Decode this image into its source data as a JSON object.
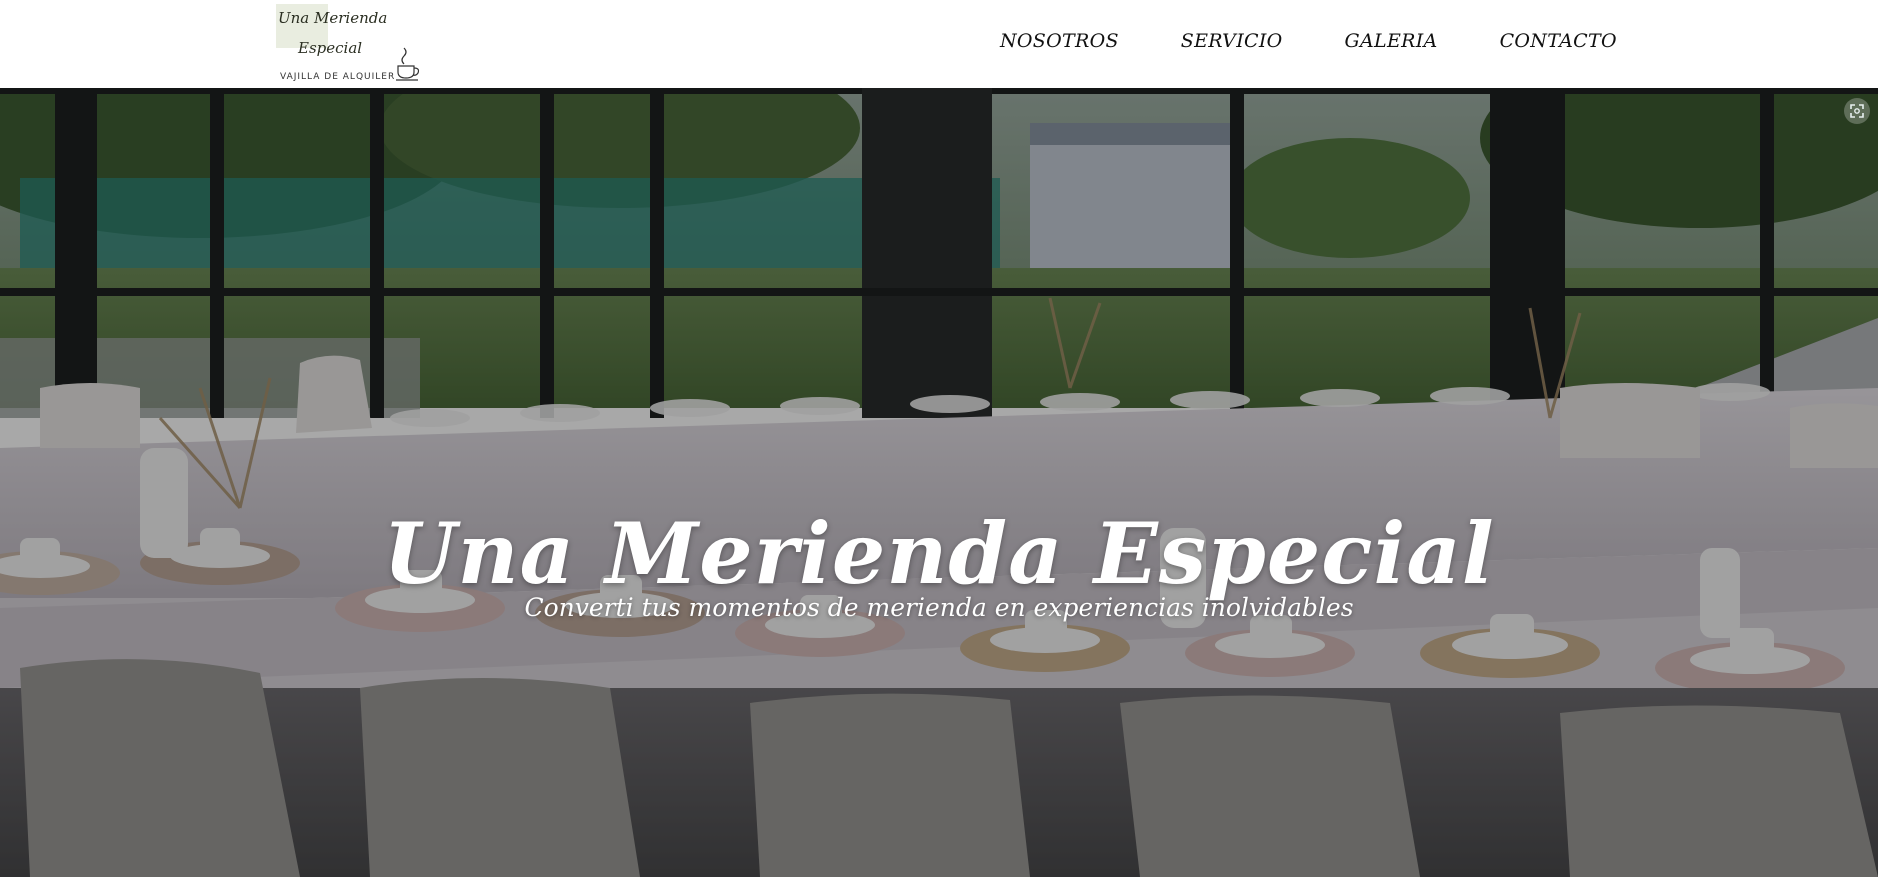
{
  "header": {
    "logo": {
      "script_line1": "Una Merienda",
      "script_line2": "Especial",
      "tagline": "VAJILLA DE ALQUILER"
    },
    "nav": [
      {
        "label": "NOSOTROS"
      },
      {
        "label": "SERVICIO"
      },
      {
        "label": "GALERIA"
      },
      {
        "label": "CONTACTO"
      }
    ]
  },
  "hero": {
    "title": "Una Merienda Especial",
    "subtitle": "Converti tus momentos de merienda en experiencias inolvidables",
    "expand_icon": "expand-icon"
  },
  "colors": {
    "text_dark": "#111111",
    "hero_text": "#ffffff",
    "logo_green": "#dfe5d3"
  }
}
